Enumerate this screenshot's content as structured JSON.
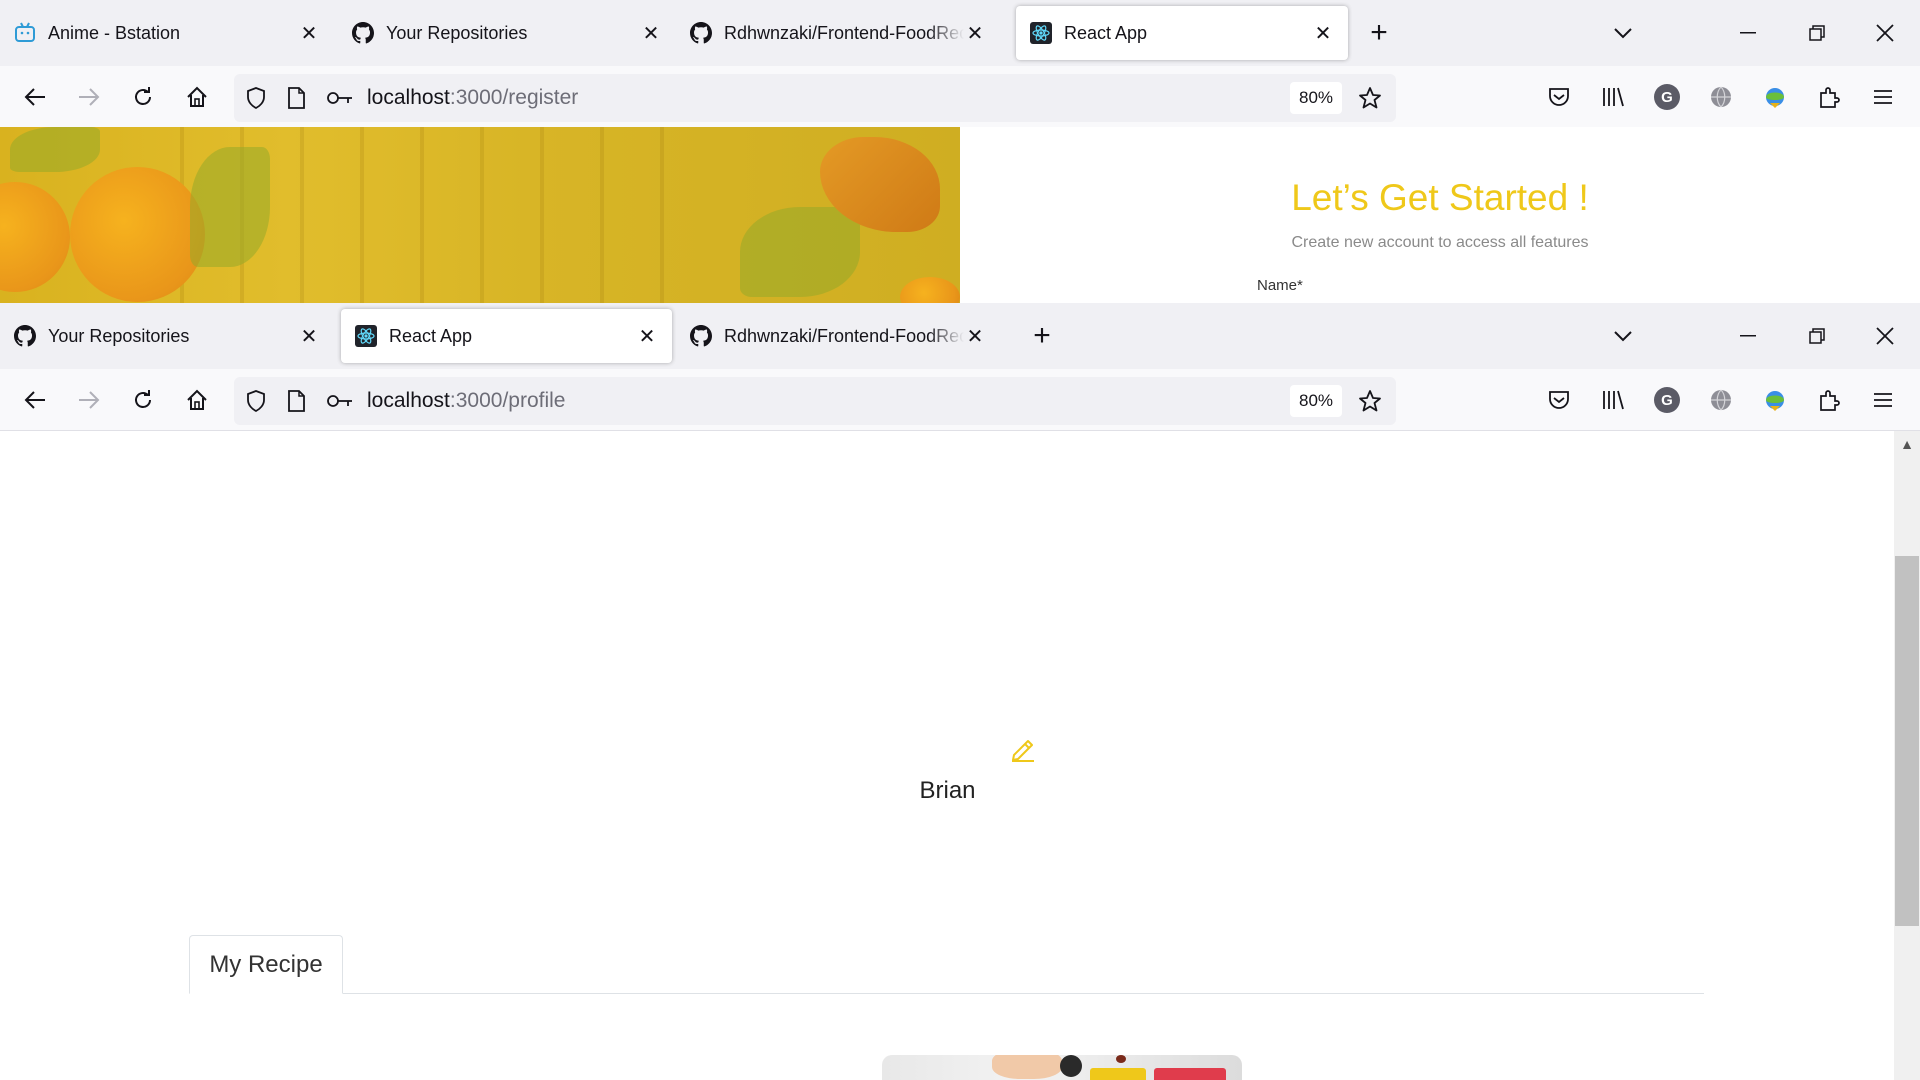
{
  "window_top": {
    "tabs": [
      {
        "title": "Anime - Bstation",
        "favicon": "bilibili-tv-icon",
        "active": false
      },
      {
        "title": "Your Repositories",
        "favicon": "github-icon",
        "active": false
      },
      {
        "title": "Rdhwnzaki/Frontend-FoodRecipe",
        "favicon": "github-icon",
        "active": false
      },
      {
        "title": "React App",
        "favicon": "react-icon",
        "active": true
      }
    ],
    "url_host": "localhost",
    "url_path": ":3000/register",
    "zoom": "80%"
  },
  "register_page": {
    "title": "Let’s Get Started !",
    "subtitle": "Create new account to access all features",
    "name_label": "Name*"
  },
  "window_bottom": {
    "tabs": [
      {
        "title": "Your Repositories",
        "favicon": "github-icon",
        "active": false
      },
      {
        "title": "React App",
        "favicon": "react-icon",
        "active": true
      },
      {
        "title": "Rdhwnzaki/Frontend-FoodRecipe",
        "favicon": "github-icon",
        "active": false
      }
    ],
    "url_host": "localhost",
    "url_path": ":3000/profile",
    "zoom": "80%"
  },
  "profile_page": {
    "username": "Brian",
    "tab_label": "My Recipe"
  },
  "toolbar": {
    "account_initial": "G"
  },
  "colors": {
    "accent_yellow": "#EFC81A",
    "delete_red": "#E03C4C"
  }
}
